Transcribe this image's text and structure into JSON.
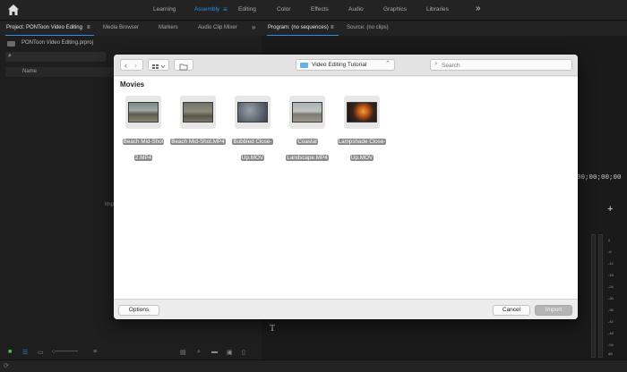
{
  "app": {
    "workspaces": [
      "Learning",
      "Assembly",
      "Editing",
      "Color",
      "Effects",
      "Audio",
      "Graphics",
      "Libraries"
    ],
    "active_workspace": "Assembly",
    "more_glyph": "»"
  },
  "left_panel": {
    "tabs": [
      "Project: PONToon Video Editing",
      "Media Browser",
      "Markers",
      "Audio Clip Mixer"
    ],
    "project_file": "PONToon Video Editing.prproj",
    "column_name": "Name",
    "import_hint": "Imp",
    "more_glyph": "»"
  },
  "right_panel": {
    "tabs": [
      "Program: (no sequences)",
      "Source: (no clips)"
    ],
    "timecode": "00;00;00;00",
    "meter_labels": [
      "0",
      "-6",
      "-12",
      "-18",
      "-24",
      "-30",
      "-36",
      "-42",
      "-48",
      "-54",
      "dB"
    ]
  },
  "dialog": {
    "location": "Video Editing Tutorial",
    "search_placeholder": "Search",
    "section": "Movies",
    "files": [
      {
        "name": "Beach Mid-Shot 2.MP4",
        "thumb": "beach"
      },
      {
        "name": "Beach Mid-Shot.MP4",
        "thumb": "beach2"
      },
      {
        "name": "Bubbled Close-Up.MOV",
        "thumb": "bubbles"
      },
      {
        "name": "Coastal Landscape.MP4",
        "thumb": "coast"
      },
      {
        "name": "Lampshade Close-Up.MOV",
        "thumb": "lamp"
      }
    ],
    "options_label": "Options",
    "cancel_label": "Cancel",
    "import_label": "Import"
  },
  "colors": {
    "accent": "#2d8ceb",
    "folder": "#67b3e9"
  }
}
